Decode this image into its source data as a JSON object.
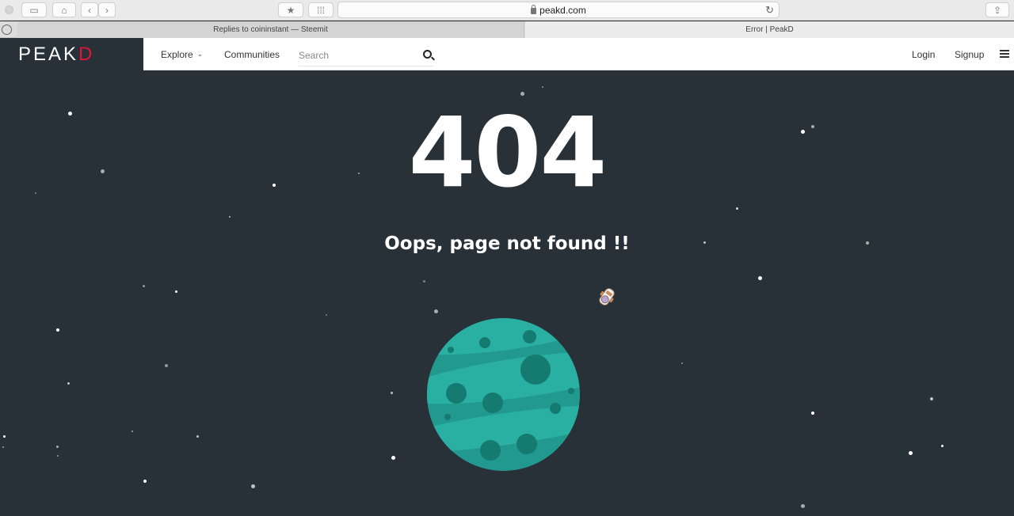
{
  "browser": {
    "address": "peakd.com",
    "tabs": [
      {
        "title": "Replies to coininstant — Steemit",
        "active": false
      },
      {
        "title": "Error | PeakD",
        "active": true
      }
    ]
  },
  "header": {
    "logo_main": "PEAK",
    "logo_accent": "D",
    "nav": {
      "explore": "Explore",
      "communities": "Communities"
    },
    "search_placeholder": "Search",
    "login": "Login",
    "signup": "Signup"
  },
  "error": {
    "code": "404",
    "message": "Oops, page not found !!"
  },
  "colors": {
    "background": "#283038",
    "brand_accent": "#e31337",
    "planet": "#22998e"
  },
  "icons": [
    "sidebar-icon",
    "home-icon",
    "back-icon",
    "forward-icon",
    "bookmark-icon",
    "grid-icon",
    "lock-icon",
    "reload-icon",
    "share-icon",
    "compass-icon",
    "chevron-down-icon",
    "search-icon",
    "menu-icon",
    "astronaut-icon"
  ]
}
